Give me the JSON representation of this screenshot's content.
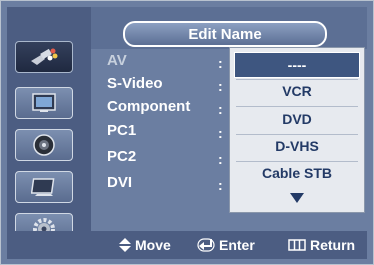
{
  "header": {
    "title": "Edit Name"
  },
  "sidebar": {
    "items": [
      {
        "icon": "input-plug-icon",
        "active": true
      },
      {
        "icon": "picture-icon",
        "active": false
      },
      {
        "icon": "sound-icon",
        "active": false
      },
      {
        "icon": "channel-icon",
        "active": false
      },
      {
        "icon": "setup-gear-icon",
        "active": false
      }
    ]
  },
  "sources": [
    {
      "label": "AV",
      "colon": ":"
    },
    {
      "label": "S-Video",
      "colon": ":"
    },
    {
      "label": "Component",
      "colon": ":"
    },
    {
      "label": "PC1",
      "colon": ":"
    },
    {
      "label": "PC2",
      "colon": ":"
    },
    {
      "label": "DVI",
      "colon": ":"
    }
  ],
  "dropdown": {
    "options": [
      "----",
      "VCR",
      "DVD",
      "D-VHS",
      "Cable STB"
    ],
    "more_icon": "down-arrow-icon"
  },
  "footer": {
    "move": "Move",
    "enter": "Enter",
    "return": "Return"
  },
  "colors": {
    "background": "#6b7ea1",
    "sidebar": "#4c5d82",
    "highlight": "#3e5680",
    "dropdown_bg": "#e7eaef",
    "dropdown_text": "#233a66"
  }
}
